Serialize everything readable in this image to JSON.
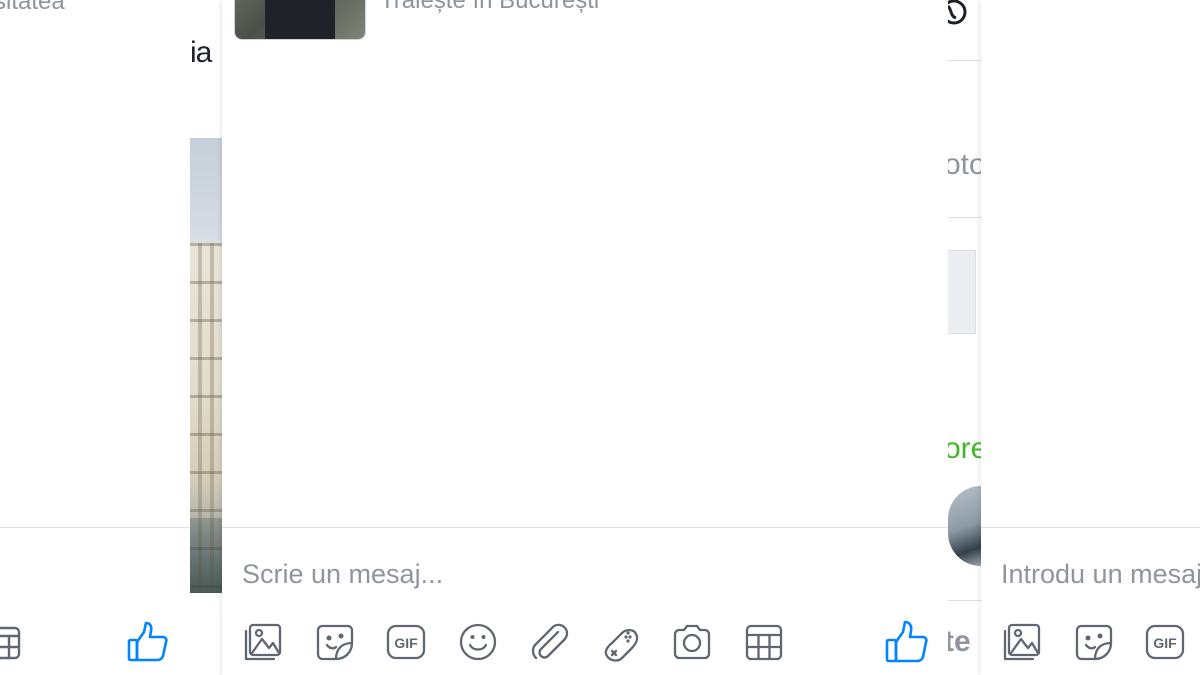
{
  "left_chat": {
    "top_text": "sitatea"
  },
  "background_page": {
    "left_heading_fragment": "ia",
    "right_photo_fragment": "oto",
    "right_green_fragment": "ore",
    "right_bottom_fragment": "te"
  },
  "center_chat": {
    "lives_in": "Trăiește în București",
    "message_placeholder": "Scrie un mesaj...",
    "toolbar": [
      {
        "icon": "photo-icon",
        "label": "Add photos"
      },
      {
        "icon": "sticker-icon",
        "label": "Choose a sticker"
      },
      {
        "icon": "gif-icon",
        "label": "Choose a GIF"
      },
      {
        "icon": "emoji-icon",
        "label": "Choose an emoji"
      },
      {
        "icon": "attach-file-icon",
        "label": "Add files"
      },
      {
        "icon": "game-icon",
        "label": "Play a game"
      },
      {
        "icon": "camera-icon",
        "label": "Take a photo"
      },
      {
        "icon": "plan-icon",
        "label": "Create a plan"
      }
    ],
    "like_icon": "thumbs-up-icon"
  },
  "right_chat": {
    "message_placeholder": "Introdu un mesaj..."
  },
  "colors": {
    "icon_gray": "#606770",
    "messenger_blue": "#0084ff",
    "placeholder_gray": "#90949c",
    "divider": "#dddfe2",
    "green": "#42b72a"
  }
}
